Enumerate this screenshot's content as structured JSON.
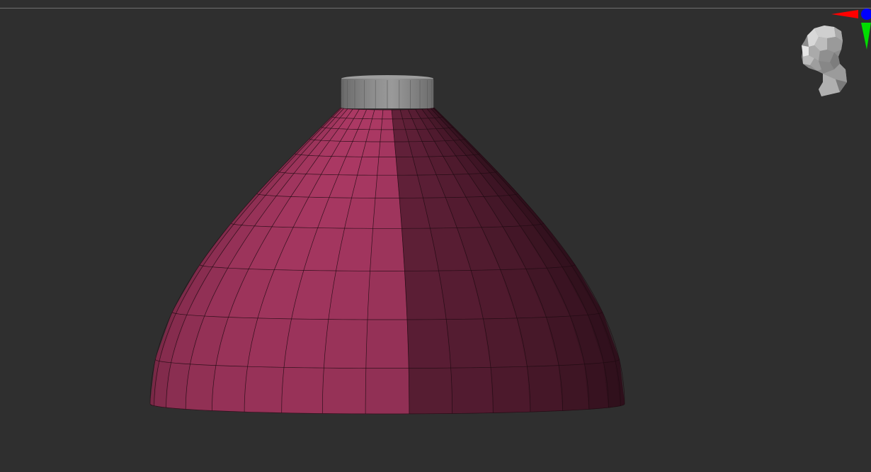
{
  "viewport": {
    "background": "#2f2f2f",
    "mesh_color": "#a3365f",
    "neck_color": "#8a8a8a",
    "wireframe_color": "#1e0a12"
  },
  "mesh": {
    "shape": "dome-lampshade",
    "polyframe": true,
    "polygroups": 1
  },
  "navigation_gizmo": {
    "icon": "head-orientation-icon",
    "axes": {
      "x": {
        "icon": "x-axis-arrow-icon",
        "color": "#ff0000"
      },
      "y": {
        "icon": "y-axis-arrow-icon",
        "color": "#00dd00"
      },
      "z": {
        "icon": "z-axis-dot-icon",
        "color": "#0000ff"
      }
    }
  }
}
